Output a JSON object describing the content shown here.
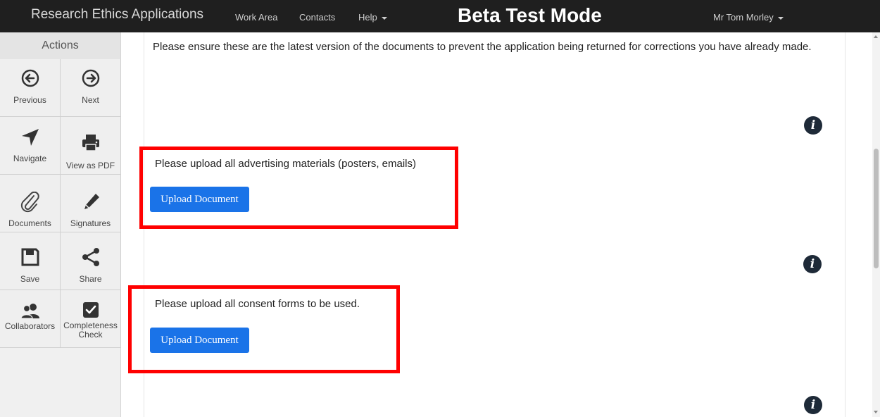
{
  "header": {
    "app_title": "Research Ethics Applications",
    "nav": [
      "Work Area",
      "Contacts",
      "Help"
    ],
    "mode_banner": "Beta Test Mode",
    "user": "Mr Tom Morley"
  },
  "sidebar": {
    "title": "Actions",
    "items": [
      {
        "label": "Previous",
        "icon": "arrow-left-circle-icon"
      },
      {
        "label": "Next",
        "icon": "arrow-right-circle-icon"
      },
      {
        "label": "Navigate",
        "icon": "location-arrow-icon"
      },
      {
        "label": "View as PDF",
        "icon": "printer-icon"
      },
      {
        "label": "Documents",
        "icon": "paperclip-icon"
      },
      {
        "label": "Signatures",
        "icon": "pencil-icon"
      },
      {
        "label": "Save",
        "icon": "floppy-disk-icon"
      },
      {
        "label": "Share",
        "icon": "share-icon"
      },
      {
        "label": "Collaborators",
        "icon": "users-icon"
      },
      {
        "label": "Completeness",
        "label2": "Check",
        "icon": "checkbox-icon"
      }
    ]
  },
  "main": {
    "intro_text": "Please ensure these are the latest version of the documents to prevent the application being returned for corrections you have already made.",
    "questions": [
      {
        "text": "Please upload all advertising materials (posters, emails)",
        "button": "Upload Document"
      },
      {
        "text": "Please upload all consent forms to be used.",
        "button": "Upload Document"
      }
    ]
  },
  "colors": {
    "navbar_bg": "#1f1f1f",
    "button_blue": "#1a73e8",
    "highlight_red": "#ff0000"
  }
}
